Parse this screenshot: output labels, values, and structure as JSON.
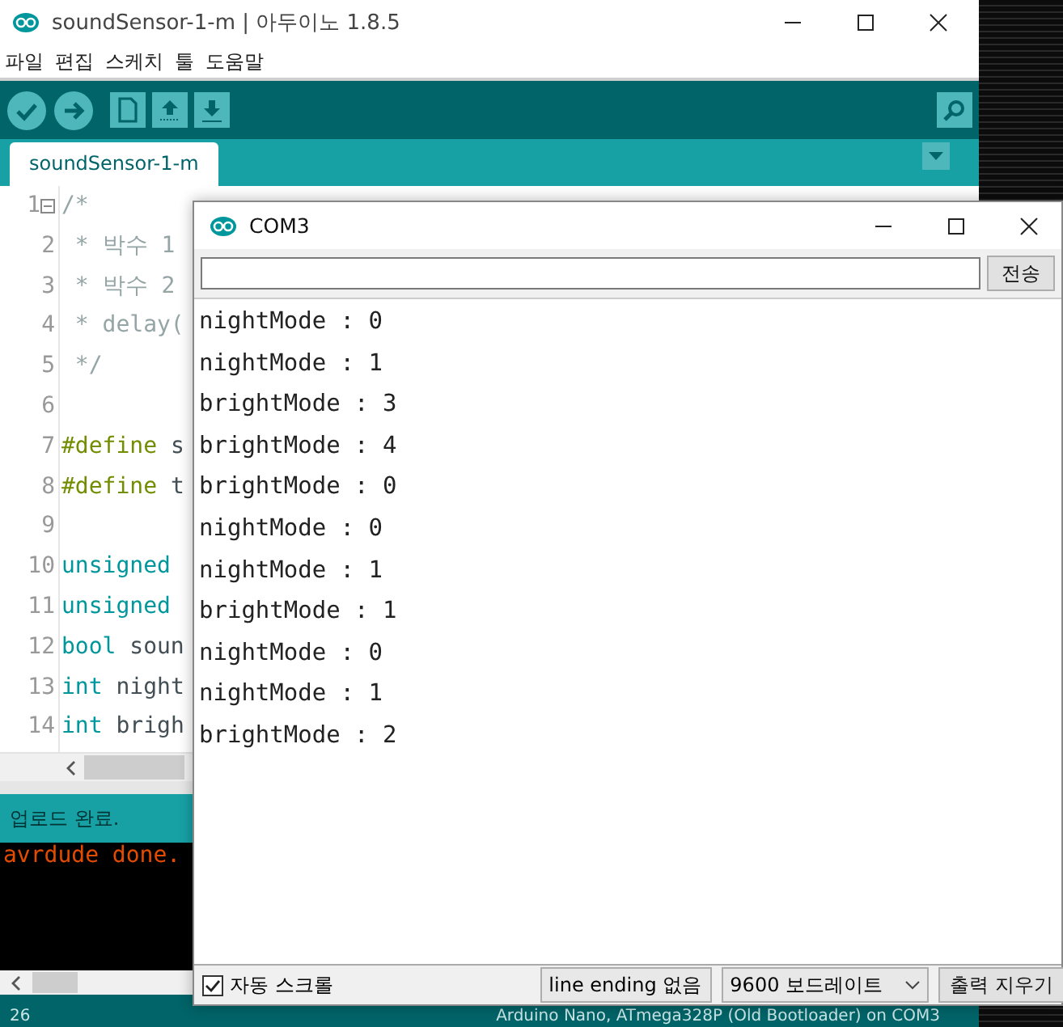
{
  "ide": {
    "title": "soundSensor-1-m | 아두이노 1.8.5",
    "menu": [
      "파일",
      "편집",
      "스케치",
      "툴",
      "도움말"
    ],
    "tabs": [
      {
        "label": "soundSensor-1-m",
        "selected": true
      }
    ],
    "code": [
      {
        "number": "1",
        "fold": true,
        "segments": [
          {
            "text": "/*",
            "kind": "comment"
          }
        ]
      },
      {
        "number": "2",
        "fold": false,
        "segments": [
          {
            "text": " * 박수 1",
            "kind": "comment"
          }
        ]
      },
      {
        "number": "3",
        "fold": false,
        "segments": [
          {
            "text": " * 박수 2",
            "kind": "comment"
          }
        ]
      },
      {
        "number": "4",
        "fold": false,
        "segments": [
          {
            "text": " * delay(",
            "kind": "comment"
          }
        ]
      },
      {
        "number": "5",
        "fold": false,
        "segments": [
          {
            "text": " */",
            "kind": "comment"
          }
        ]
      },
      {
        "number": "6",
        "fold": false
      },
      {
        "number": "7",
        "fold": false,
        "segments": [
          {
            "text": "#define",
            "kind": "directive"
          },
          {
            "text": " s",
            "kind": "plain"
          }
        ]
      },
      {
        "number": "8",
        "fold": false,
        "segments": [
          {
            "text": "#define",
            "kind": "directive"
          },
          {
            "text": " t",
            "kind": "plain"
          }
        ]
      },
      {
        "number": "9",
        "fold": false
      },
      {
        "number": "10",
        "fold": false,
        "segments": [
          {
            "text": "unsigned",
            "kind": "type"
          }
        ]
      },
      {
        "number": "11",
        "fold": false,
        "segments": [
          {
            "text": "unsigned",
            "kind": "type"
          }
        ]
      },
      {
        "number": "12",
        "fold": false,
        "segments": [
          {
            "text": "bool",
            "kind": "type"
          },
          {
            "text": " soun",
            "kind": "plain"
          }
        ]
      },
      {
        "number": "13",
        "fold": false,
        "segments": [
          {
            "text": "int",
            "kind": "type"
          },
          {
            "text": " night",
            "kind": "plain"
          }
        ]
      },
      {
        "number": "14",
        "fold": false,
        "segments": [
          {
            "text": "int",
            "kind": "type"
          },
          {
            "text": " brigh",
            "kind": "plain"
          }
        ]
      }
    ],
    "console_status": "업로드 완료.",
    "console_lines": [
      "avrdude done."
    ],
    "status_bar": {
      "line": "26",
      "board": "Arduino Nano, ATmega328P (Old Bootloader) on COM3"
    }
  },
  "serial_monitor": {
    "title": "COM3",
    "send_button": "전송",
    "output": [
      "nightMode : 0",
      "nightMode : 1",
      "brightMode : 3",
      "brightMode : 4",
      "brightMode : 0",
      "nightMode : 0",
      "nightMode : 1",
      "brightMode : 1",
      "nightMode : 0",
      "nightMode : 1",
      "brightMode : 2"
    ],
    "autoscroll": {
      "label": "자동 스크롤",
      "checked": true
    },
    "line_ending": "line ending 없음",
    "baud": "9600 보드레이트",
    "clear_button": "출력 지우기"
  }
}
